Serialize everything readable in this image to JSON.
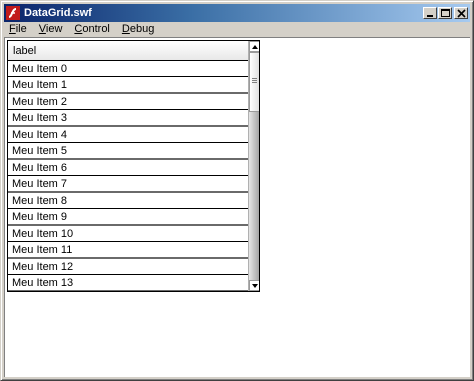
{
  "window": {
    "title": "DataGrid.swf",
    "title_gradient": [
      "#0a246a",
      "#a6caf0"
    ],
    "controls": [
      "minimize-icon",
      "maximize-icon",
      "close-icon"
    ]
  },
  "menu": {
    "items": [
      {
        "label": "File",
        "mnemonic": "F",
        "rest": "ile"
      },
      {
        "label": "View",
        "mnemonic": "V",
        "rest": "iew"
      },
      {
        "label": "Control",
        "mnemonic": "C",
        "rest": "ontrol"
      },
      {
        "label": "Debug",
        "mnemonic": "D",
        "rest": "ebug"
      }
    ]
  },
  "grid": {
    "column_header": "label",
    "rows": [
      "Meu Item 0",
      "Meu Item 1",
      "Meu Item 2",
      "Meu Item 3",
      "Meu Item 4",
      "Meu Item 5",
      "Meu Item 6",
      "Meu Item 7",
      "Meu Item 8",
      "Meu Item 9",
      "Meu Item 10",
      "Meu Item 11",
      "Meu Item 12",
      "Meu Item 13"
    ]
  }
}
